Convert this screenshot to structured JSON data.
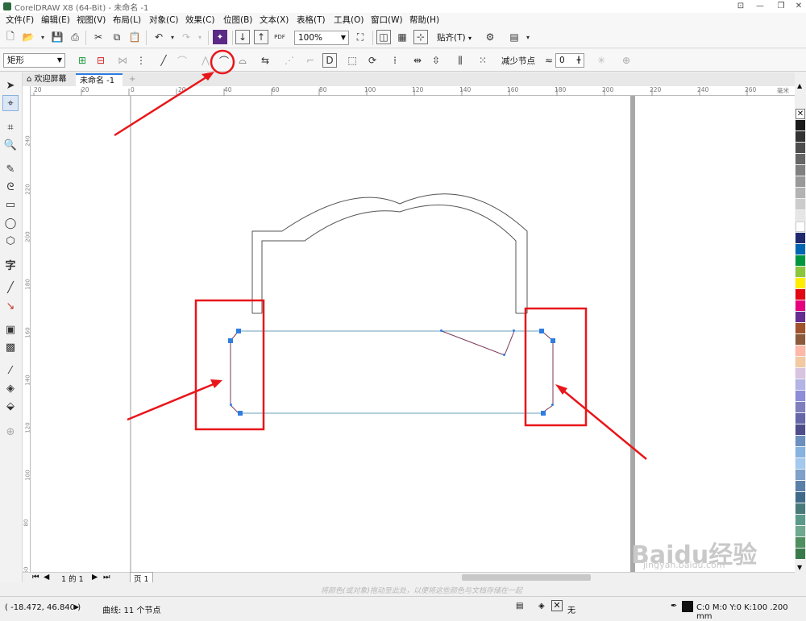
{
  "window": {
    "title": "CorelDRAW X8 (64-Bit) - 未命名 -1"
  },
  "menu": [
    "文件(F)",
    "编辑(E)",
    "视图(V)",
    "布局(L)",
    "对象(C)",
    "效果(C)",
    "位图(B)",
    "文本(X)",
    "表格(T)",
    "工具(O)",
    "窗口(W)",
    "帮助(H)"
  ],
  "toolbar": {
    "zoom": "100%",
    "snap_label": "贴齐(T)"
  },
  "property_bar": {
    "shape_select": "矩形",
    "reduce_nodes_label": "减少节点",
    "smoothness_value": "0"
  },
  "tabs": {
    "welcome": "欢迎屏幕",
    "document": "未命名 -1",
    "add": "+"
  },
  "ruler": {
    "h_labels": [
      "20",
      "20",
      "0",
      "20",
      "40",
      "60",
      "80",
      "100",
      "120",
      "140",
      "160",
      "180",
      "200",
      "220",
      "240",
      "260"
    ],
    "unit": "毫米",
    "v_labels": [
      "240",
      "220",
      "200",
      "180",
      "160",
      "140",
      "120",
      "100",
      "80",
      "60"
    ]
  },
  "pagenav": {
    "counter": "1 的 1",
    "page_tab": "页 1"
  },
  "hint": "将颜色(或对象)拖动至此处，以便将这些颜色与文档存储在一起",
  "status": {
    "coords": "( -18.472, 46.840 )",
    "object_info": "曲线: 11 个节点",
    "fill_none": "无",
    "outline_info": "C:0 M:0 Y:0 K:100  .200 mm"
  },
  "colors": {
    "accent": "#2e7de0",
    "annotation": "#e8161a",
    "palette": [
      "#1a1a1a",
      "#333333",
      "#4d4d4d",
      "#666666",
      "#808080",
      "#999999",
      "#b3b3b3",
      "#cccccc",
      "#e6e6e6",
      "#ffffff",
      "#1f2a6e",
      "#0066b3",
      "#009640",
      "#8cc63f",
      "#ffed00",
      "#e30613",
      "#e6007e",
      "#662d91",
      "#a0522d",
      "#8b5a3c",
      "#ffb7a8",
      "#f2c9a0",
      "#d8c3e0",
      "#b3b3e6",
      "#8c8cd9",
      "#7f7fbf",
      "#6666aa",
      "#4d4d8c",
      "#6b8fbf",
      "#86b3e0",
      "#a3c9ee",
      "#7fa0c9",
      "#5a7fa8",
      "#3f6a8a",
      "#497a7a",
      "#5b9a8a",
      "#6fa88f",
      "#4f8f5f",
      "#3a7a4a"
    ]
  },
  "watermark": {
    "logo": "Baidu经验",
    "url": "jingyan.baidu.com"
  }
}
